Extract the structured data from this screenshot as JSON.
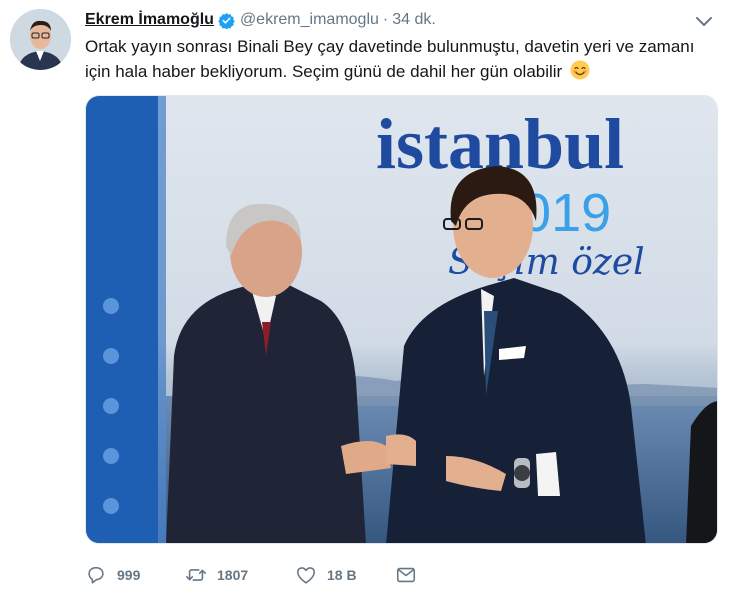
{
  "tweet": {
    "author_name": "Ekrem İmamoğlu",
    "handle": "@ekrem_imamoglu",
    "separator": "·",
    "time": "34 dk.",
    "text": "Ortak yayın sonrası Binali Bey çay davetinde bulunmuştu, davetin yeri ve zamanı için hala haber bekliyorum. Seçim günü de dahil her gün olabilir",
    "verified": true
  },
  "media": {
    "backdrop_title": "istanbul",
    "backdrop_year": "2019",
    "backdrop_subtitle": "Seçim özel"
  },
  "actions": {
    "reply_count": "999",
    "retweet_count": "1807",
    "like_count": "18 B"
  },
  "colors": {
    "text": "#14171a",
    "secondary": "#657786",
    "verified_blue": "#1da1f2",
    "backdrop_blue": "#1e4aa0"
  }
}
